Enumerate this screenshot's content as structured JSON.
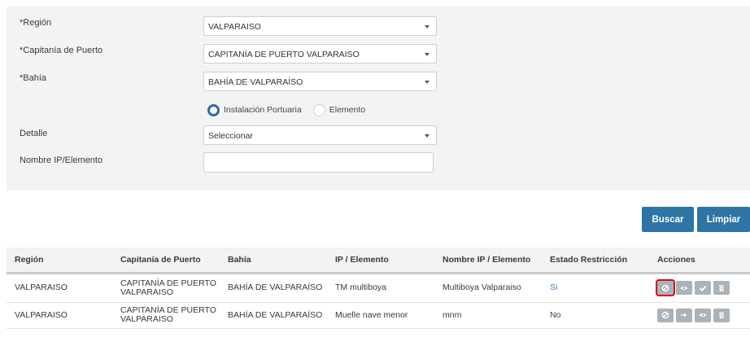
{
  "filters": {
    "region": {
      "label": "*Región",
      "value": "VALPARAISO"
    },
    "capitania": {
      "label": "*Capitanía de Puerto",
      "value": "CAPITANÍA DE PUERTO VALPARAISO"
    },
    "bahia": {
      "label": "*Bahía",
      "value": "BAHÍA DE VALPARAÍSO"
    },
    "type_radio": {
      "options": [
        {
          "label": "Instalación Portuaria",
          "selected": true
        },
        {
          "label": "Elemento",
          "selected": false
        }
      ]
    },
    "detalle": {
      "label": "Detalle",
      "value": "Seleccionar"
    },
    "nombre": {
      "label": "Nombre IP/Elemento",
      "value": "",
      "placeholder": ""
    }
  },
  "buttons": {
    "search": "Buscar",
    "clear": "Limpiar"
  },
  "colors": {
    "accent": "#2e75a6",
    "link": "#3b7dc4",
    "action_button": "#aab3ba",
    "highlight": "#e0001b"
  },
  "table": {
    "headers": [
      "Región",
      "Capitanía de Puerto",
      "Bahía",
      "IP / Elemento",
      "Nombre IP / Elemento",
      "Estado Restricción",
      "Acciones"
    ],
    "rows": [
      {
        "region": "VALPARAISO",
        "capitania_line1": "CAPITANÍA DE PUERTO",
        "capitania_line2": "VALPARAISO",
        "bahia": "BAHÍA DE VALPARAÍSO",
        "ip": "TM multiboya",
        "nombre": "Multiboya Valparaiso",
        "estado": "Si",
        "actions": [
          "block-icon",
          "eye-icon",
          "check-icon",
          "trash-icon"
        ]
      },
      {
        "region": "VALPARAISO",
        "capitania_line1": "CAPITANÍA DE PUERTO",
        "capitania_line2": "VALPARAISO",
        "bahia": "BAHÍA DE VALPARAÍSO",
        "ip": "Muelle nave menor",
        "nombre": "mnm",
        "estado": "No",
        "actions": [
          "block-icon",
          "login-icon",
          "eye-icon",
          "trash-icon"
        ]
      }
    ]
  }
}
